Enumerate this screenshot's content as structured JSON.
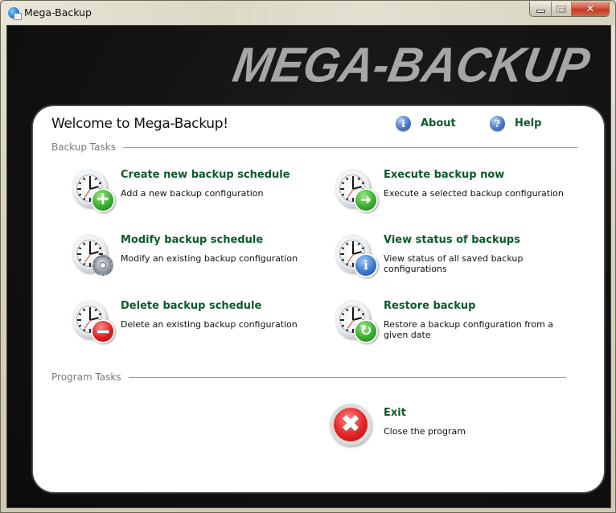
{
  "window": {
    "title": "Mega-Backup",
    "controls": {
      "minimize_glyph": "",
      "maximize_glyph": "",
      "close_glyph": "✕"
    }
  },
  "banner": {
    "logo_text": "MEGA-BACKUP"
  },
  "panel": {
    "welcome": "Welcome to Mega-Backup!",
    "links": [
      {
        "label": "About",
        "icon": "info-icon",
        "glyph": "i"
      },
      {
        "label": "Help",
        "icon": "help-icon",
        "glyph": "?"
      }
    ],
    "sections": {
      "backup_tasks": "Backup Tasks",
      "program_tasks": "Program Tasks"
    },
    "backup_tasks": [
      {
        "title": "Create new backup schedule",
        "description": "Add a new backup configuration",
        "badge": "plus-icon",
        "glyph": "+"
      },
      {
        "title": "Execute backup now",
        "description": "Execute a selected backup configuration",
        "badge": "arrow-right-icon",
        "glyph": "➜"
      },
      {
        "title": "Modify backup schedule",
        "description": "Modify an existing backup configuration",
        "badge": "gear-icon",
        "glyph": ""
      },
      {
        "title": "View status of backups",
        "description": "View status of all saved backup configurations",
        "badge": "info-icon",
        "glyph": "i"
      },
      {
        "title": "Delete backup schedule",
        "description": "Delete an existing backup configuration",
        "badge": "minus-icon",
        "glyph": ""
      },
      {
        "title": "Restore backup",
        "description": "Restore a backup configuration from a given date",
        "badge": "restore-icon",
        "glyph": "↻"
      }
    ],
    "program_tasks": [
      {
        "title": "Exit",
        "description": "Close the program",
        "badge": "exit-icon",
        "glyph": "✖"
      }
    ]
  },
  "colors": {
    "link_green": "#0d5a2c",
    "section_gray": "#7a7a7a",
    "banner_bg": "#111111",
    "logo_gray": "#a6a6a6"
  }
}
